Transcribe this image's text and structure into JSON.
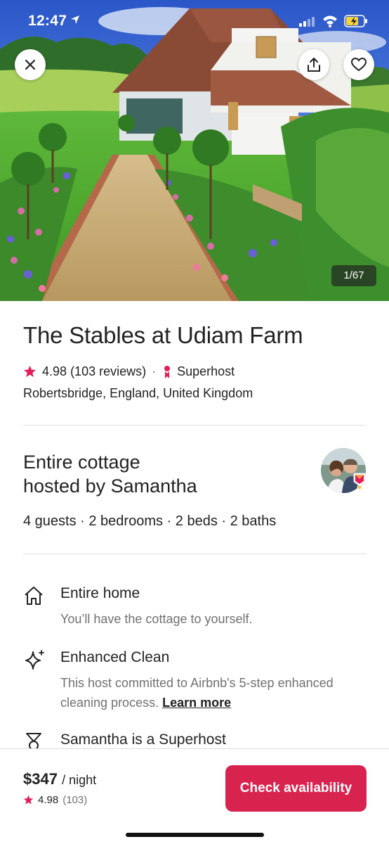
{
  "status_bar": {
    "time": "12:47"
  },
  "hero": {
    "photo_counter": "1/67"
  },
  "listing": {
    "title": "The Stables at Udiam Farm",
    "rating": "4.98",
    "reviews": "(103 reviews)",
    "separator": "·",
    "host_badge": "Superhost",
    "location": "Robertsbridge, England, United Kingdom"
  },
  "host": {
    "title_line1": "Entire cottage",
    "title_line2": "hosted by Samantha",
    "capacity": "4 guests · 2 bedrooms · 2 beds · 2 baths"
  },
  "features": [
    {
      "icon": "home-icon",
      "title": "Entire home",
      "desc": "You’ll have the cottage to yourself."
    },
    {
      "icon": "sparkle-icon",
      "title": "Enhanced Clean",
      "desc": "This host committed to Airbnb's 5-step enhanced cleaning process.",
      "link": "Learn more"
    },
    {
      "icon": "superhost-icon",
      "title": "Samantha is a Superhost"
    }
  ],
  "footer": {
    "price": "$347",
    "price_unit": "/ night",
    "rating": "4.98",
    "review_count": "(103)",
    "cta_label": "Check availability"
  },
  "colors": {
    "brand": "#d9234f",
    "star": "#e51d56",
    "text": "#222222",
    "muted": "#717171",
    "divider": "#dddddd"
  }
}
